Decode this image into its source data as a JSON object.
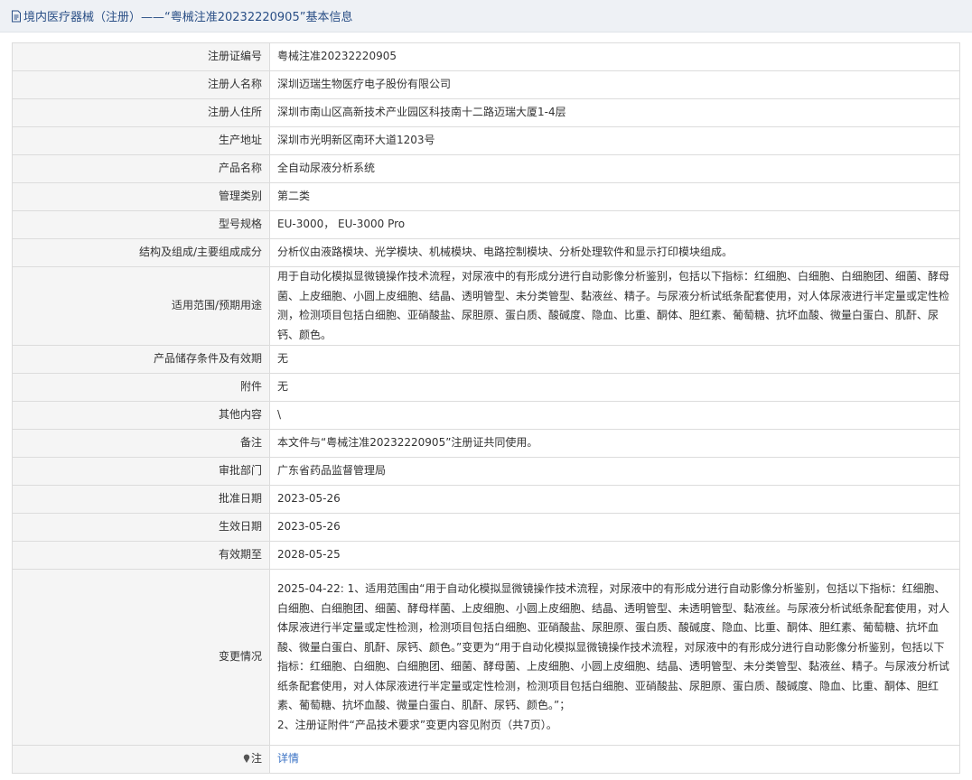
{
  "header": {
    "title": "境内医疗器械（注册）——“粤械注准20232220905”基本信息"
  },
  "rows": [
    {
      "label": "注册证编号",
      "value": "粤械注准20232220905"
    },
    {
      "label": "注册人名称",
      "value": "深圳迈瑞生物医疗电子股份有限公司"
    },
    {
      "label": "注册人住所",
      "value": "深圳市南山区高新技术产业园区科技南十二路迈瑞大厦1-4层"
    },
    {
      "label": "生产地址",
      "value": "深圳市光明新区南环大道1203号"
    },
    {
      "label": "产品名称",
      "value": "全自动尿液分析系统"
    },
    {
      "label": "管理类别",
      "value": "第二类"
    },
    {
      "label": "型号规格",
      "value": "EU-3000， EU-3000 Pro"
    },
    {
      "label": "结构及组成/主要组成成分",
      "value": "分析仪由液路模块、光学模块、机械模块、电路控制模块、分析处理软件和显示打印模块组成。"
    },
    {
      "label": "适用范围/预期用途",
      "value": "用于自动化模拟显微镜操作技术流程，对尿液中的有形成分进行自动影像分析鉴别，包括以下指标：红细胞、白细胞、白细胞团、细菌、酵母菌、上皮细胞、小圆上皮细胞、结晶、透明管型、未分类管型、黏液丝、精子。与尿液分析试纸条配套使用，对人体尿液进行半定量或定性检测，检测项目包括白细胞、亚硝酸盐、尿胆原、蛋白质、酸碱度、隐血、比重、酮体、胆红素、葡萄糖、抗坏血酸、微量白蛋白、肌酐、尿钙、颜色。"
    },
    {
      "label": "产品储存条件及有效期",
      "value": "无"
    },
    {
      "label": "附件",
      "value": "无"
    },
    {
      "label": "其他内容",
      "value": "\\"
    },
    {
      "label": "备注",
      "value": "本文件与“粤械注准20232220905”注册证共同使用。"
    },
    {
      "label": "审批部门",
      "value": "广东省药品监督管理局"
    },
    {
      "label": "批准日期",
      "value": "2023-05-26"
    },
    {
      "label": "生效日期",
      "value": "2023-05-26"
    },
    {
      "label": "有效期至",
      "value": "2028-05-25"
    },
    {
      "label": "变更情况",
      "value": "2025-04-22: 1、适用范围由“用于自动化模拟显微镜操作技术流程，对尿液中的有形成分进行自动影像分析鉴别，包括以下指标：红细胞、白细胞、白细胞团、细菌、酵母样菌、上皮细胞、小圆上皮细胞、结晶、透明管型、未透明管型、黏液丝。与尿液分析试纸条配套使用，对人体尿液进行半定量或定性检测，检测项目包括白细胞、亚硝酸盐、尿胆原、蛋白质、酸碱度、隐血、比重、酮体、胆红素、葡萄糖、抗坏血酸、微量白蛋白、肌酐、尿钙、颜色。”变更为“用于自动化模拟显微镜操作技术流程，对尿液中的有形成分进行自动影像分析鉴别，包括以下指标：红细胞、白细胞、白细胞团、细菌、酵母菌、上皮细胞、小圆上皮细胞、结晶、透明管型、未分类管型、黏液丝、精子。与尿液分析试纸条配套使用，对人体尿液进行半定量或定性检测，检测项目包括白细胞、亚硝酸盐、尿胆原、蛋白质、酸碱度、隐血、比重、酮体、胆红素、葡萄糖、抗坏血酸、微量白蛋白、肌酐、尿钙、颜色。”；\n2、注册证附件“产品技术要求”变更内容见附页（共7页）。"
    }
  ],
  "note": {
    "label": "注",
    "link_text": "详情"
  },
  "colors": {
    "title_text": "#2a4f86",
    "label_bg": "#f5f5f5",
    "border": "#dcdcdc",
    "link": "#3b73c5"
  },
  "icons": {
    "title_icon": "document-icon",
    "note_icon": "map-pin-icon"
  }
}
